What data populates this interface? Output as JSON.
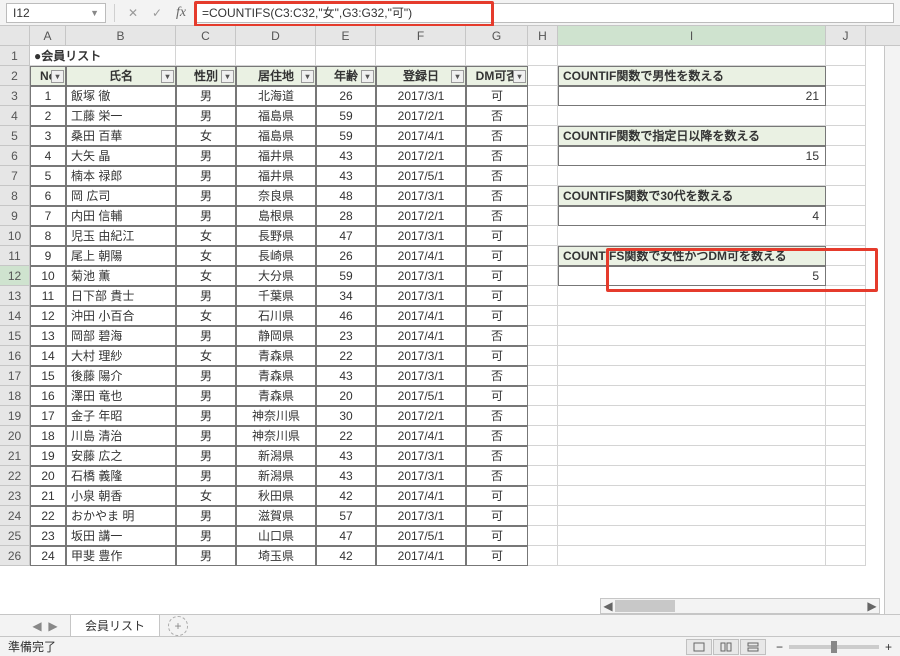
{
  "nameBox": "I12",
  "formula": "=COUNTIFS(C3:C32,\"女\",G3:G32,\"可\")",
  "title": "●会員リスト",
  "colHeaders": [
    "A",
    "B",
    "C",
    "D",
    "E",
    "F",
    "G",
    "H",
    "I",
    "J"
  ],
  "tableHeaders": {
    "no": "No",
    "name": "氏名",
    "sex": "性別",
    "area": "居住地",
    "age": "年齢",
    "date": "登録日",
    "dm": "DM可否"
  },
  "rows": [
    {
      "n": "1",
      "name": "飯塚 徹",
      "sex": "男",
      "area": "北海道",
      "age": "26",
      "date": "2017/3/1",
      "dm": "可"
    },
    {
      "n": "2",
      "name": "工藤 栄一",
      "sex": "男",
      "area": "福島県",
      "age": "59",
      "date": "2017/2/1",
      "dm": "否"
    },
    {
      "n": "3",
      "name": "桑田 百華",
      "sex": "女",
      "area": "福島県",
      "age": "59",
      "date": "2017/4/1",
      "dm": "否"
    },
    {
      "n": "4",
      "name": "大矢 晶",
      "sex": "男",
      "area": "福井県",
      "age": "43",
      "date": "2017/2/1",
      "dm": "否"
    },
    {
      "n": "5",
      "name": "楠本 禄郎",
      "sex": "男",
      "area": "福井県",
      "age": "43",
      "date": "2017/5/1",
      "dm": "否"
    },
    {
      "n": "6",
      "name": "岡 広司",
      "sex": "男",
      "area": "奈良県",
      "age": "48",
      "date": "2017/3/1",
      "dm": "否"
    },
    {
      "n": "7",
      "name": "内田 信輔",
      "sex": "男",
      "area": "島根県",
      "age": "28",
      "date": "2017/2/1",
      "dm": "否"
    },
    {
      "n": "8",
      "name": "児玉 由紀江",
      "sex": "女",
      "area": "長野県",
      "age": "47",
      "date": "2017/3/1",
      "dm": "可"
    },
    {
      "n": "9",
      "name": "尾上 朝陽",
      "sex": "女",
      "area": "長崎県",
      "age": "26",
      "date": "2017/4/1",
      "dm": "可"
    },
    {
      "n": "10",
      "name": "菊池 薫",
      "sex": "女",
      "area": "大分県",
      "age": "59",
      "date": "2017/3/1",
      "dm": "可"
    },
    {
      "n": "11",
      "name": "日下部 貴士",
      "sex": "男",
      "area": "千葉県",
      "age": "34",
      "date": "2017/3/1",
      "dm": "可"
    },
    {
      "n": "12",
      "name": "沖田 小百合",
      "sex": "女",
      "area": "石川県",
      "age": "46",
      "date": "2017/4/1",
      "dm": "可"
    },
    {
      "n": "13",
      "name": "岡部 碧海",
      "sex": "男",
      "area": "静岡県",
      "age": "23",
      "date": "2017/4/1",
      "dm": "否"
    },
    {
      "n": "14",
      "name": "大村 理紗",
      "sex": "女",
      "area": "青森県",
      "age": "22",
      "date": "2017/3/1",
      "dm": "可"
    },
    {
      "n": "15",
      "name": "後藤 陽介",
      "sex": "男",
      "area": "青森県",
      "age": "43",
      "date": "2017/3/1",
      "dm": "否"
    },
    {
      "n": "16",
      "name": "澤田 竜也",
      "sex": "男",
      "area": "青森県",
      "age": "20",
      "date": "2017/5/1",
      "dm": "可"
    },
    {
      "n": "17",
      "name": "金子 年昭",
      "sex": "男",
      "area": "神奈川県",
      "age": "30",
      "date": "2017/2/1",
      "dm": "否"
    },
    {
      "n": "18",
      "name": "川島 清治",
      "sex": "男",
      "area": "神奈川県",
      "age": "22",
      "date": "2017/4/1",
      "dm": "否"
    },
    {
      "n": "19",
      "name": "安藤 広之",
      "sex": "男",
      "area": "新潟県",
      "age": "43",
      "date": "2017/3/1",
      "dm": "否"
    },
    {
      "n": "20",
      "name": "石橋 義隆",
      "sex": "男",
      "area": "新潟県",
      "age": "43",
      "date": "2017/3/1",
      "dm": "否"
    },
    {
      "n": "21",
      "name": "小泉 朝香",
      "sex": "女",
      "area": "秋田県",
      "age": "42",
      "date": "2017/4/1",
      "dm": "可"
    },
    {
      "n": "22",
      "name": "おかやま 明",
      "sex": "男",
      "area": "滋賀県",
      "age": "57",
      "date": "2017/3/1",
      "dm": "可"
    },
    {
      "n": "23",
      "name": "坂田 講一",
      "sex": "男",
      "area": "山口県",
      "age": "47",
      "date": "2017/5/1",
      "dm": "可"
    },
    {
      "n": "24",
      "name": "甲斐 豊作",
      "sex": "男",
      "area": "埼玉県",
      "age": "42",
      "date": "2017/4/1",
      "dm": "可"
    }
  ],
  "side": {
    "b1": {
      "label": "COUNTIF関数で男性を数える",
      "val": "21"
    },
    "b2": {
      "label": "COUNTIF関数で指定日以降を数える",
      "val": "15"
    },
    "b3": {
      "label": "COUNTIFS関数で30代を数える",
      "val": "4"
    },
    "b4": {
      "label": "COUNTIFS関数で女性かつDM可を数える",
      "val": "5"
    }
  },
  "sheetTab": "会員リスト",
  "status": "準備完了"
}
